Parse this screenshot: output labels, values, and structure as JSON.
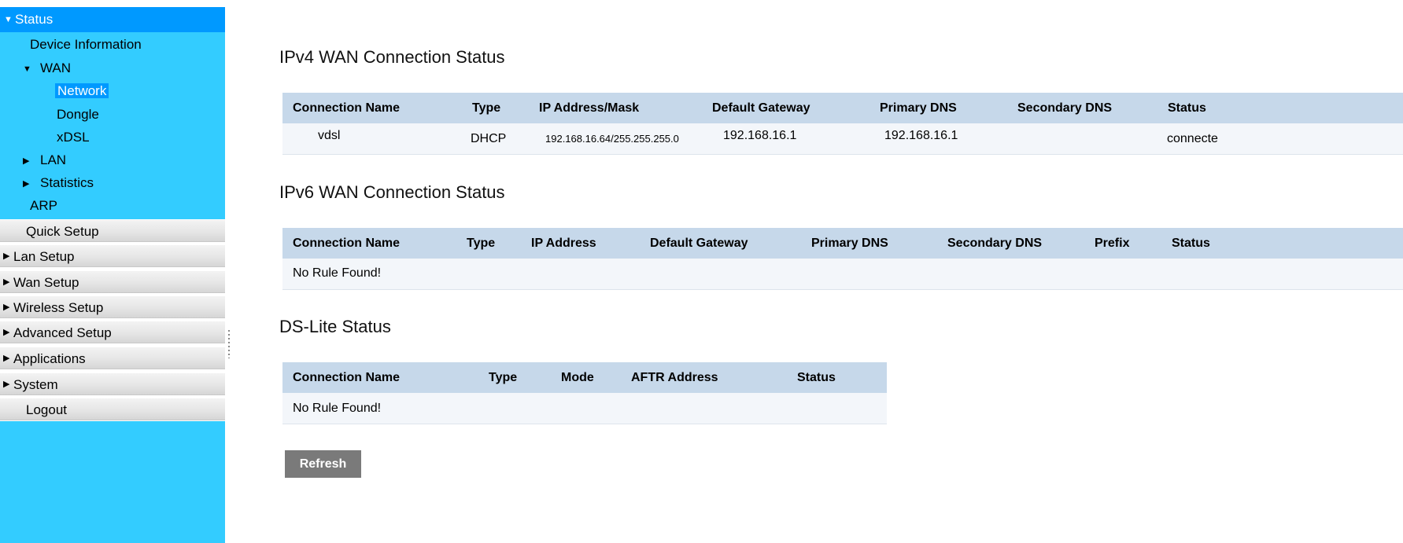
{
  "sidebar": {
    "status": "Status",
    "device_information": "Device Information",
    "wan": "WAN",
    "network": "Network",
    "dongle": "Dongle",
    "xdsl": "xDSL",
    "lan": "LAN",
    "statistics": "Statistics",
    "arp": "ARP",
    "menu": [
      "Quick Setup",
      "Lan Setup",
      "Wan Setup",
      "Wireless Setup",
      "Advanced Setup",
      "Applications",
      "System",
      "Logout"
    ]
  },
  "ipv4": {
    "title": "IPv4 WAN Connection Status",
    "headers": [
      "Connection Name",
      "Type",
      "IP Address/Mask",
      "Default Gateway",
      "Primary DNS",
      "Secondary DNS",
      "Status"
    ],
    "row": [
      "vdsl",
      "DHCP",
      "192.168.16.64/255.255.255.0",
      "192.168.16.1",
      "192.168.16.1",
      "",
      "connecte"
    ]
  },
  "ipv6": {
    "title": "IPv6 WAN Connection Status",
    "headers": [
      "Connection Name",
      "Type",
      "IP Address",
      "Default Gateway",
      "Primary DNS",
      "Secondary DNS",
      "Prefix",
      "Status"
    ],
    "empty": "No Rule Found!"
  },
  "dslite": {
    "title": "DS-Lite Status",
    "headers": [
      "Connection Name",
      "Type",
      "Mode",
      "AFTR Address",
      "Status"
    ],
    "empty": "No Rule Found!"
  },
  "refresh_label": "Refresh"
}
